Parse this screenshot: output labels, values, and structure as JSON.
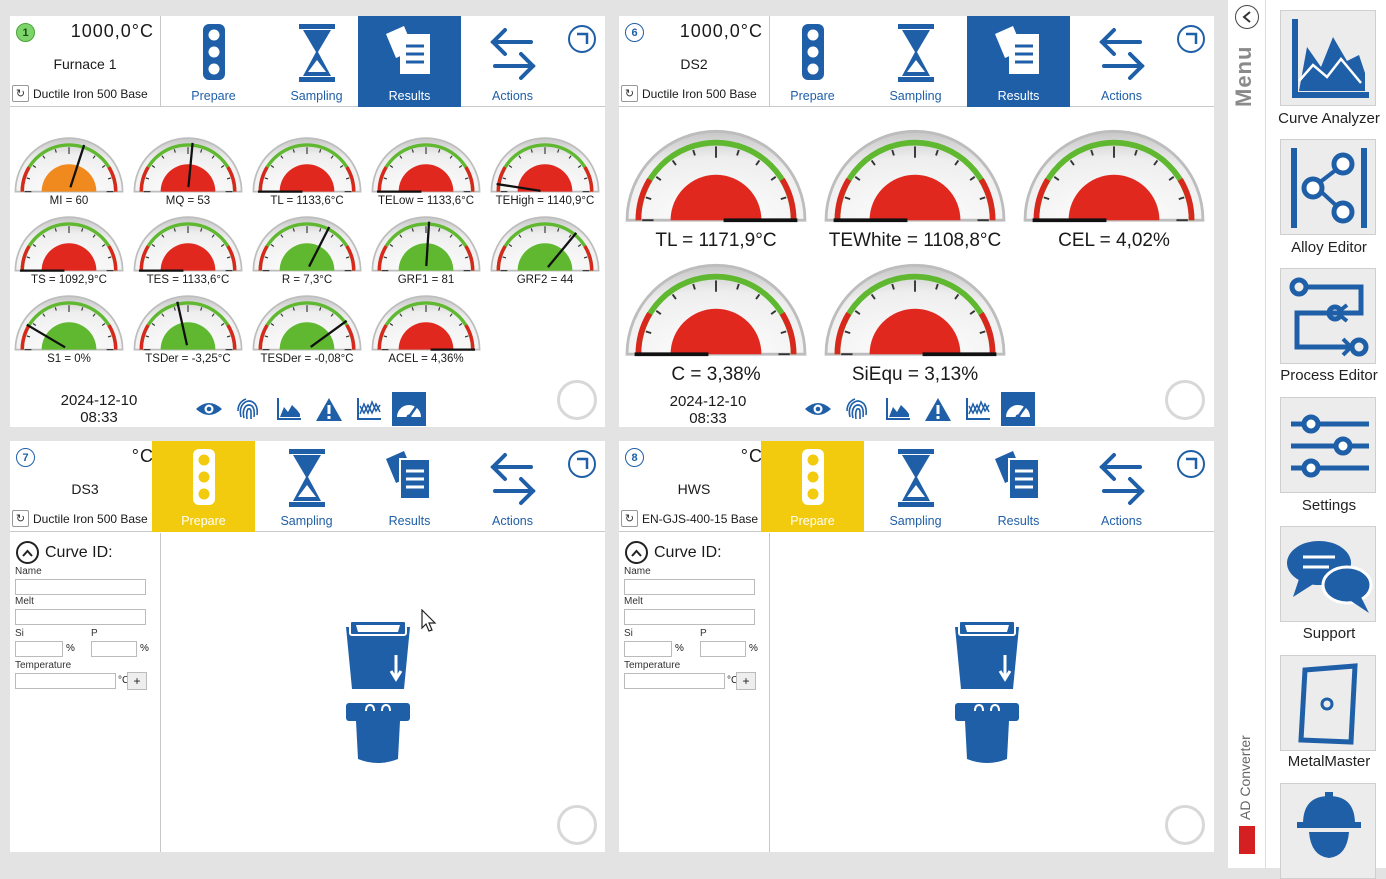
{
  "colors": {
    "accent_blue": "#1f5fa8",
    "prepare_yellow": "#f2ca0e",
    "gauge_red": "#e0281e",
    "gauge_green": "#5fb830",
    "gauge_orange": "#f08a1e",
    "status_green": "#7cd46a"
  },
  "tabs": [
    "Prepare",
    "Sampling",
    "Results",
    "Actions"
  ],
  "panels": [
    {
      "number": "1",
      "temperature": "1000,0°C",
      "name": "Furnace 1",
      "alloy": "Ductile Iron 500 Base",
      "active_tab": "Results",
      "status": "connected",
      "gauges": [
        {
          "label": "MI = 60",
          "color": "orange",
          "value_fraction": 0.6
        },
        {
          "label": "MQ = 53",
          "color": "red",
          "value_fraction": 0.53
        },
        {
          "label": "TL = 1133,6°C",
          "color": "red",
          "value_fraction": 0.0
        },
        {
          "label": "TELow = 1133,6°C",
          "color": "red",
          "value_fraction": 0.0
        },
        {
          "label": "TEHigh = 1140,9°C",
          "color": "red",
          "value_fraction": 0.05
        },
        {
          "label": "TS = 1092,9°C",
          "color": "red",
          "value_fraction": 0.0
        },
        {
          "label": "TES = 1133,6°C",
          "color": "red",
          "value_fraction": 0.0
        },
        {
          "label": "R = 7,3°C",
          "color": "green",
          "value_fraction": 0.65
        },
        {
          "label": "GRF1 = 81",
          "color": "green",
          "value_fraction": 0.52
        },
        {
          "label": "GRF2 = 44",
          "color": "green",
          "value_fraction": 0.72
        },
        {
          "label": "S1 = 0%",
          "color": "green",
          "value_fraction": 0.17
        },
        {
          "label": "TSDer = -3,25°C",
          "color": "green",
          "value_fraction": 0.43
        },
        {
          "label": "TESDer = -0,08°C",
          "color": "green",
          "value_fraction": 0.8
        },
        {
          "label": "ACEL = 4,36%",
          "color": "red",
          "value_fraction": 1.0
        }
      ],
      "date": "2024-12-10",
      "time": "08:33"
    },
    {
      "number": "6",
      "temperature": "1000,0°C",
      "name": "DS2",
      "alloy": "Ductile Iron 500 Base",
      "active_tab": "Results",
      "status": "idle",
      "gauges": [
        {
          "label": "TL = 1171,9°C",
          "color": "red",
          "value_fraction": 1.0
        },
        {
          "label": "TEWhite = 1108,8°C",
          "color": "red",
          "value_fraction": 0.0
        },
        {
          "label": "CEL = 4,02%",
          "color": "red",
          "value_fraction": 0.0
        },
        {
          "label": "C = 3,38%",
          "color": "red",
          "value_fraction": 0.0
        },
        {
          "label": "SiEqu = 3,13%",
          "color": "red",
          "value_fraction": 1.0
        }
      ],
      "date": "2024-12-10",
      "time": "08:33"
    },
    {
      "number": "7",
      "temperature": "°C",
      "name": "DS3",
      "alloy": "Ductile Iron 500 Base",
      "active_tab": "Prepare",
      "status": "idle",
      "form": {
        "title": "Curve ID:",
        "name_label": "Name",
        "melt_label": "Melt",
        "si_label": "Si",
        "p_label": "P",
        "pct": "%",
        "temp_label": "Temperature",
        "temp_unit": "°C",
        "add": "+"
      }
    },
    {
      "number": "8",
      "temperature": "°C",
      "name": "HWS",
      "alloy": "EN-GJS-400-15 Base",
      "active_tab": "Prepare",
      "status": "idle",
      "form": {
        "title": "Curve ID:",
        "name_label": "Name",
        "melt_label": "Melt",
        "si_label": "Si",
        "p_label": "P",
        "pct": "%",
        "temp_label": "Temperature",
        "temp_unit": "°C",
        "add": "+"
      }
    }
  ],
  "toolbar_icons": [
    "eye-icon",
    "fingerprint-icon",
    "chart-icon",
    "warning-icon",
    "curves-icon",
    "gauge-icon"
  ],
  "sidebar": {
    "menu_label": "Menu",
    "converter_label": "AD Converter",
    "items": [
      {
        "label": "Curve Analyzer",
        "icon": "curve-analyzer-icon"
      },
      {
        "label": "Alloy Editor",
        "icon": "alloy-editor-icon"
      },
      {
        "label": "Process Editor",
        "icon": "process-editor-icon"
      },
      {
        "label": "Settings",
        "icon": "settings-sliders-icon"
      },
      {
        "label": "Support",
        "icon": "support-chat-icon"
      },
      {
        "label": "MetalMaster",
        "icon": "metalmaster-icon"
      },
      {
        "label": "",
        "icon": "operator-icon"
      }
    ]
  }
}
